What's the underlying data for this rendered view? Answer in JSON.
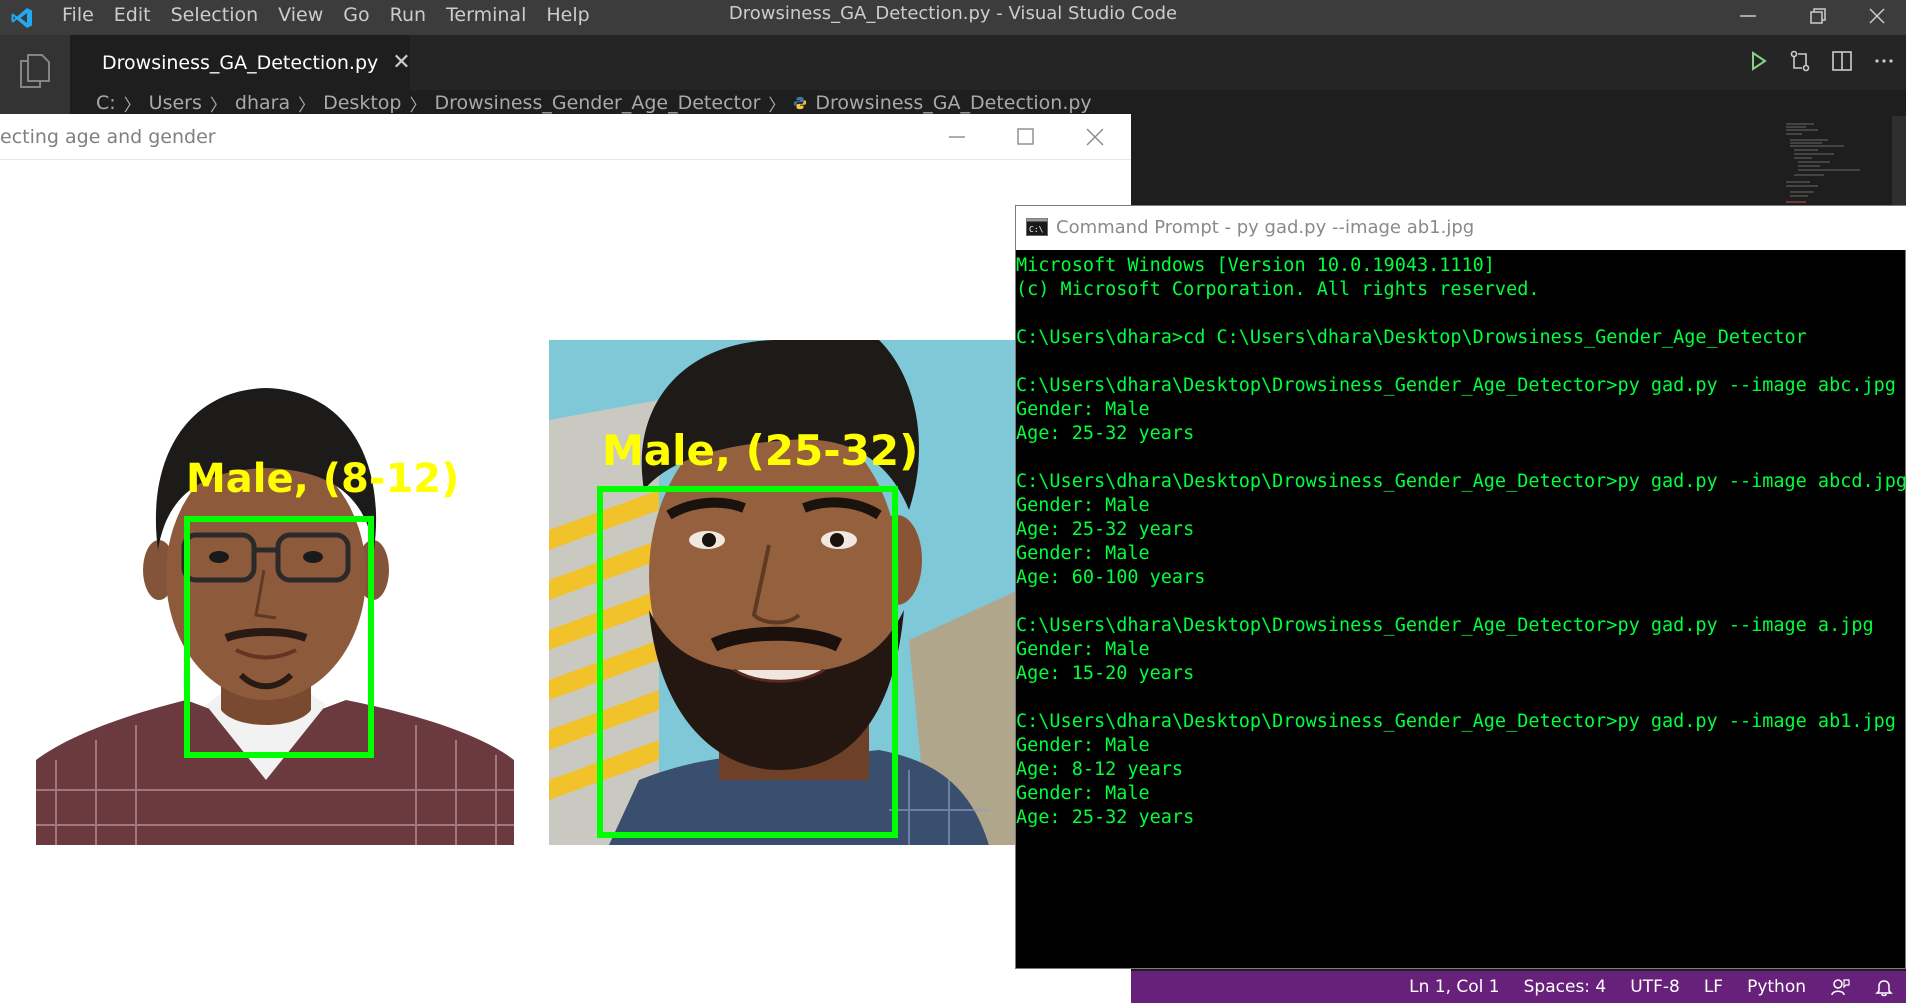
{
  "vscode": {
    "menu": [
      "File",
      "Edit",
      "Selection",
      "View",
      "Go",
      "Run",
      "Terminal",
      "Help"
    ],
    "window_title": "Drowsiness_GA_Detection.py - Visual Studio Code",
    "tab": {
      "label": "Drowsiness_GA_Detection.py"
    },
    "breadcrumb": [
      "C:",
      "Users",
      "dhara",
      "Desktop",
      "Drowsiness_Gender_Age_Detector",
      "Drowsiness_GA_Detection.py"
    ],
    "status": {
      "position": "Ln 1, Col 1",
      "spaces": "Spaces: 4",
      "encoding": "UTF-8",
      "eol": "LF",
      "language": "Python"
    },
    "colors": {
      "statusbar": "#68217a",
      "titlebar": "#3c3c3c",
      "accent": "#007acc"
    }
  },
  "image_window": {
    "title": "ecting age and gender",
    "labels": [
      "Male, (8-12)",
      "Male, (25-32)"
    ],
    "box_color": "#00ff00",
    "label_color": "#ffff00"
  },
  "cmd": {
    "title": "Command Prompt - py  gad.py --image ab1.jpg",
    "lines": [
      "Microsoft Windows [Version 10.0.19043.1110]",
      "(c) Microsoft Corporation. All rights reserved.",
      "",
      "C:\\Users\\dhara>cd C:\\Users\\dhara\\Desktop\\Drowsiness_Gender_Age_Detector",
      "",
      "C:\\Users\\dhara\\Desktop\\Drowsiness_Gender_Age_Detector>py gad.py --image abc.jpg",
      "Gender: Male",
      "Age: 25-32 years",
      "",
      "C:\\Users\\dhara\\Desktop\\Drowsiness_Gender_Age_Detector>py gad.py --image abcd.jpg",
      "Gender: Male",
      "Age: 25-32 years",
      "Gender: Male",
      "Age: 60-100 years",
      "",
      "C:\\Users\\dhara\\Desktop\\Drowsiness_Gender_Age_Detector>py gad.py --image a.jpg",
      "Gender: Male",
      "Age: 15-20 years",
      "",
      "C:\\Users\\dhara\\Desktop\\Drowsiness_Gender_Age_Detector>py gad.py --image ab1.jpg",
      "Gender: Male",
      "Age: 8-12 years",
      "Gender: Male",
      "Age: 25-32 years"
    ],
    "text_color": "#00ff3c"
  }
}
